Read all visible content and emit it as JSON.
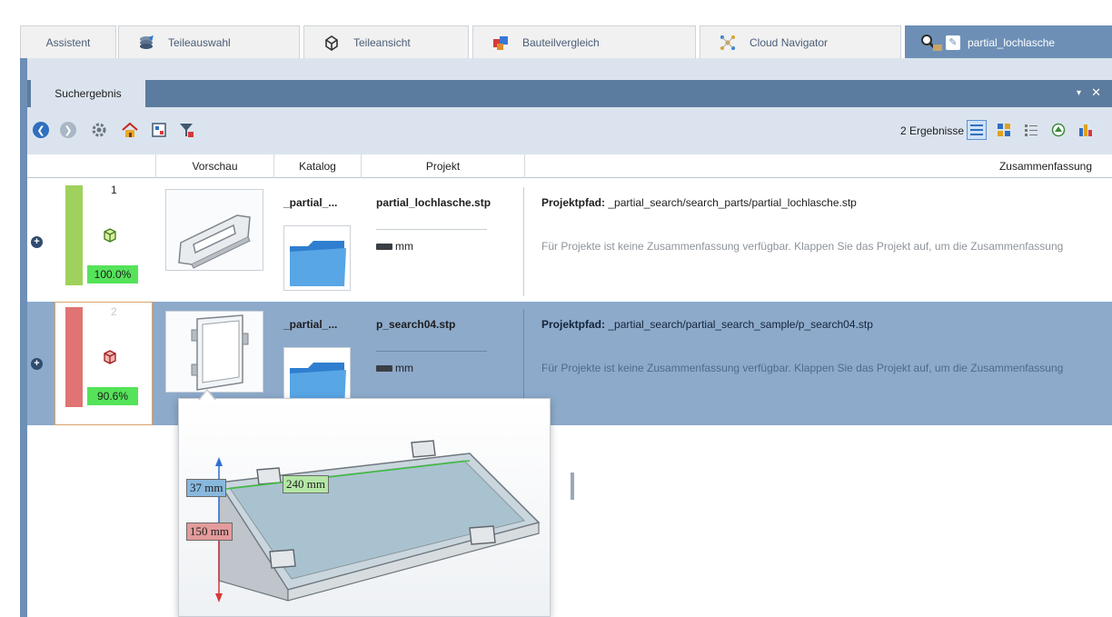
{
  "tabs": [
    {
      "label": "Assistent",
      "icon": "assistant-icon"
    },
    {
      "label": "Teileauswahl",
      "icon": "parts-selection-icon"
    },
    {
      "label": "Teileansicht",
      "icon": "part-view-icon"
    },
    {
      "label": "Bauteilvergleich",
      "icon": "component-compare-icon"
    },
    {
      "label": "Cloud Navigator",
      "icon": "cloud-navigator-icon"
    },
    {
      "label": "partial_lochlasche",
      "icon": "partial-search-icon",
      "active": true
    }
  ],
  "panel": {
    "subtab_label": "Suchergebnis",
    "dropdown_glyph": "▾",
    "close_glyph": "✕"
  },
  "toolbar": {
    "results_label": "2 Ergebnisse",
    "buttons": [
      "back-icon",
      "forward-icon",
      "settings-gear-icon",
      "home-icon",
      "export-icon",
      "filter-icon"
    ],
    "view_buttons": [
      "list-view-icon",
      "grid-view-icon",
      "detail-view-icon",
      "3d-view-icon",
      "chart-view-icon"
    ]
  },
  "table": {
    "columns": [
      "Vorschau",
      "Katalog",
      "Projekt",
      "Zusammenfassung"
    ],
    "rows": [
      {
        "rank": "1",
        "match_percent": "100.0%",
        "bar_color": "#9fd15c",
        "catalog": "_partial_...",
        "project": "partial_lochlasche.stp",
        "unit": "mm",
        "path_label": "Projektpfad:",
        "path": "_partial_search/search_parts/partial_lochlasche.stp",
        "summary": "Für Projekte ist keine Zusammenfassung verfügbar. Klappen Sie das Projekt auf, um die Zusammenfassung"
      },
      {
        "rank": "2",
        "match_percent": "90.6%",
        "bar_color": "#e07373",
        "catalog": "_partial_...",
        "project": "p_search04.stp",
        "unit": "mm",
        "path_label": "Projektpfad:",
        "path": "_partial_search/partial_search_sample/p_search04.stp",
        "summary": "Für Projekte ist keine Zusammenfassung verfügbar. Klappen Sie das Projekt auf, um die Zusammenfassung"
      }
    ]
  },
  "preview_popup": {
    "dim_height": "37 mm",
    "dim_length": "240 mm",
    "dim_width": "150 mm"
  },
  "colors": {
    "active_tab": "#6d8fb6",
    "panel_bg": "#dbe4ee",
    "selected_row": "#8daacb",
    "match_good": "#55e35a"
  }
}
